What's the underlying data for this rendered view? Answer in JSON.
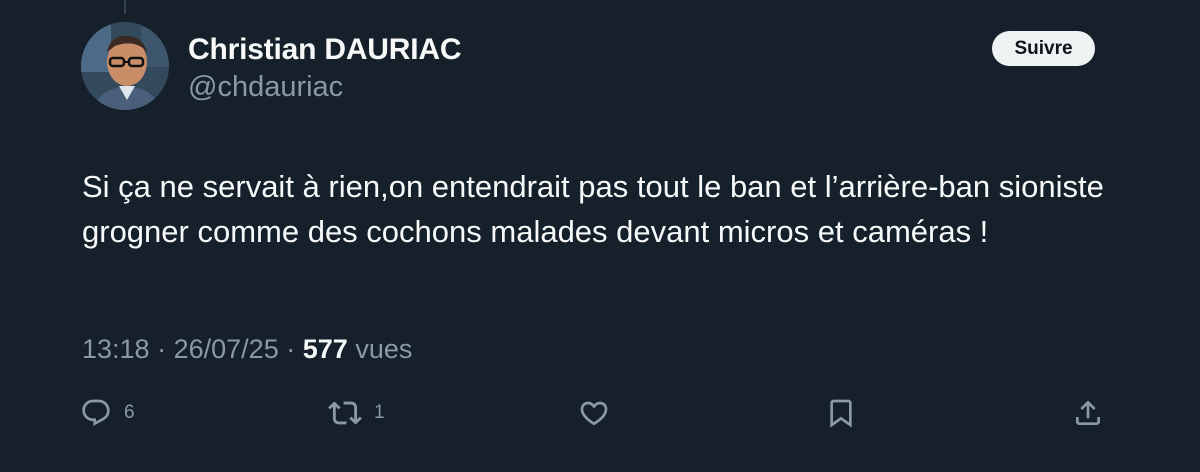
{
  "author": {
    "display_name": "Christian DAURIAC",
    "handle": "@chdauriac"
  },
  "follow_label": "Suivre",
  "tweet": {
    "text": "Si ça ne servait à rien,on entendrait pas tout le ban et l’arrière-ban sioniste grogner comme des cochons malades devant micros et caméras !",
    "time": "13:18",
    "date": "26/07/25",
    "separator": "·",
    "views_count": "577",
    "views_label": "vues"
  },
  "actions": {
    "reply": {
      "icon": "reply-icon",
      "count": "6"
    },
    "retweet": {
      "icon": "retweet-icon",
      "count": "1"
    },
    "like": {
      "icon": "heart-icon"
    },
    "bookmark": {
      "icon": "bookmark-icon"
    },
    "share": {
      "icon": "share-icon"
    }
  },
  "colors": {
    "background": "#15202b",
    "primary_text": "#f7f9f9",
    "secondary_text": "#8b98a5",
    "button_bg": "#eff3f4"
  }
}
